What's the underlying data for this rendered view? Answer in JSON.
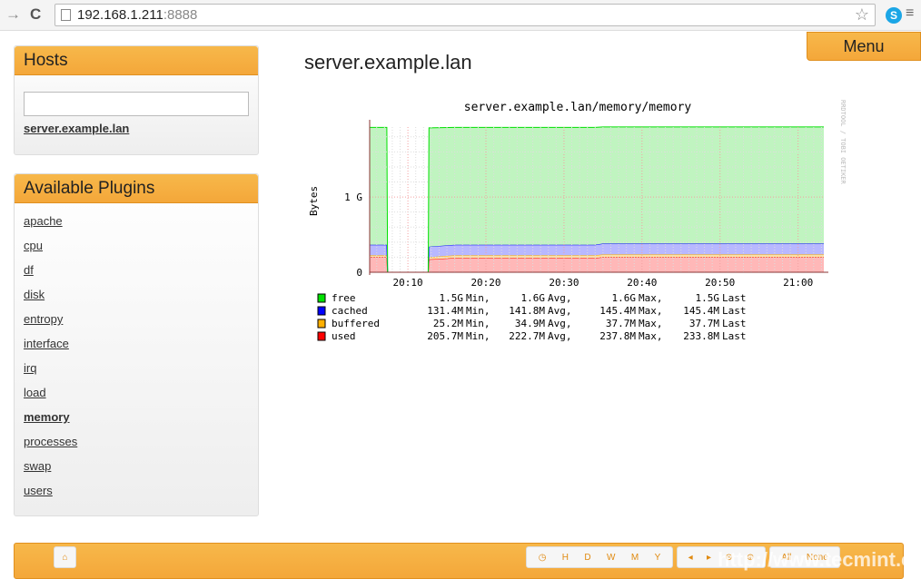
{
  "browser": {
    "url_host": "192.168.1.211",
    "url_port": ":8888",
    "back": "→",
    "reload": "C",
    "star": "☆",
    "skype": "S",
    "menu": "≡"
  },
  "sidebar": {
    "hosts_title": "Hosts",
    "host_filter_value": "",
    "hosts": [
      "server.example.lan"
    ],
    "plugins_title": "Available Plugins",
    "plugins": [
      "apache",
      "cpu",
      "df",
      "disk",
      "entropy",
      "interface",
      "irq",
      "load",
      "memory",
      "processes",
      "swap",
      "users"
    ],
    "active_plugin": "memory"
  },
  "menu_label": "Menu",
  "page_title": "server.example.lan",
  "chart_data": {
    "type": "area",
    "title": "server.example.lan/memory/memory",
    "ylabel": "Bytes",
    "watermark": "RRDTOOL / TOBI OETIKER",
    "yticks": [
      {
        "v": 0,
        "label": "0"
      },
      {
        "v": 1,
        "label": "1 G"
      }
    ],
    "ylim_gb": [
      0,
      1.93
    ],
    "xticks": [
      "20:10",
      "20:20",
      "20:30",
      "20:40",
      "20:50",
      "21:00"
    ],
    "x_minutes": [
      5.1,
      7.3,
      7.4,
      12.6,
      12.7,
      16,
      34,
      35,
      63.3
    ],
    "series": [
      {
        "name": "used",
        "color": "#ff0000",
        "fill": "#ffb8b8",
        "gb": [
          0.2,
          0.2,
          0,
          0,
          0.17,
          0.19,
          0.19,
          0.2,
          0.2
        ]
      },
      {
        "name": "buffered",
        "color": "#ffb000",
        "fill": "#ffe0a0",
        "gb": [
          0.025,
          0.025,
          0,
          0,
          0.03,
          0.035,
          0.035,
          0.037,
          0.037
        ]
      },
      {
        "name": "cached",
        "color": "#0000ff",
        "fill": "#b8b8ff",
        "gb": [
          0.14,
          0.14,
          0,
          0,
          0.14,
          0.14,
          0.14,
          0.145,
          0.145
        ]
      },
      {
        "name": "free",
        "color": "#00e000",
        "fill": "#c0f4c0",
        "gb": [
          1.56,
          1.56,
          0,
          0,
          1.58,
          1.56,
          1.56,
          1.55,
          1.55
        ]
      }
    ],
    "legend": [
      {
        "name": "free",
        "color": "#00e000",
        "min": "1.5G",
        "avg": "1.6G",
        "max": "1.6G",
        "last": "1.5G"
      },
      {
        "name": "cached",
        "color": "#0000ff",
        "min": "131.4M",
        "avg": "141.8M",
        "max": "145.4M",
        "last": "145.4M"
      },
      {
        "name": "buffered",
        "color": "#ffb000",
        "min": "25.2M",
        "avg": "34.9M",
        "max": "37.7M",
        "last": "37.7M"
      },
      {
        "name": "used",
        "color": "#ff0000",
        "min": "205.7M",
        "avg": "222.7M",
        "max": "237.8M",
        "last": "233.8M"
      }
    ]
  },
  "footer": {
    "home": "⌂",
    "ranges": [
      "◷",
      "H",
      "D",
      "W",
      "M",
      "Y"
    ],
    "nav": [
      "◂",
      "▸",
      "⊖",
      "⊕"
    ],
    "extra": [
      "All",
      "None"
    ],
    "watermark": "http://www.tecmint.com"
  }
}
